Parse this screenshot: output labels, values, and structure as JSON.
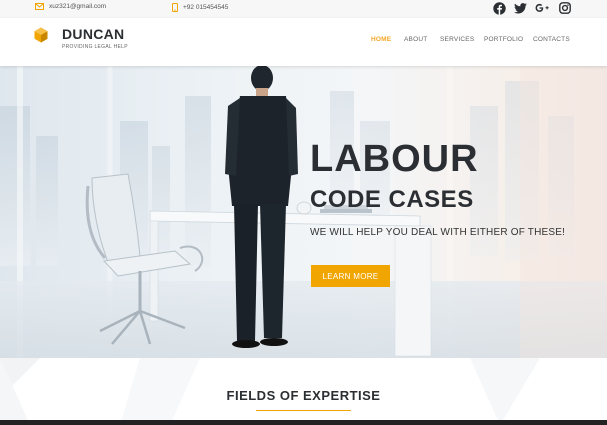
{
  "topbar": {
    "email": "xuz321@gmail.com",
    "phone": "+92 015454545",
    "social_icons": [
      "facebook-icon",
      "twitter-icon",
      "google-plus-icon",
      "instagram-icon"
    ]
  },
  "header": {
    "brand": "DUNCAN",
    "tagline": "PROVIDING LEGAL HELP",
    "nav": [
      "HOME",
      "ABOUT",
      "SERVICES",
      "PORTFOLIO",
      "CONTACTS"
    ],
    "active_nav": "HOME"
  },
  "hero": {
    "title_line1": "LABOUR",
    "title_line2": "CODE CASES",
    "subtitle": "WE WILL HELP YOU DEAL WITH EITHER OF THESE!",
    "button": "LEARN MORE"
  },
  "expertise": {
    "title": "FIELDS OF EXPERTISE"
  },
  "colors": {
    "accent": "#f0a500",
    "heading": "#2b2f33",
    "nav_active": "#f5a623"
  }
}
